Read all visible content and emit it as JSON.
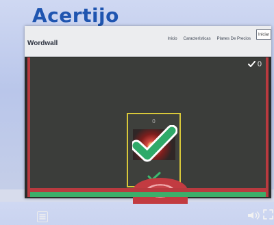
{
  "slide": {
    "title": "Acertijo"
  },
  "app": {
    "brand": "Wordwall",
    "nav": [
      "Inicio",
      "Características",
      "Planes De Precios"
    ],
    "login_label": "Iniciar"
  },
  "game": {
    "score_value": "0",
    "card_count": "0"
  },
  "colors": {
    "title_blue": "#1f55b0",
    "frame_red": "#b83a3f",
    "card_border": "#d8c83a",
    "check_green": "#2faa69",
    "check_border": "#ffffff"
  },
  "icons": {
    "score": "check-icon",
    "answer": "big-check-icon",
    "small_check": "small-check-icon",
    "menu": "menu-icon",
    "sound": "speaker-icon",
    "fullscreen": "fullscreen-icon"
  }
}
